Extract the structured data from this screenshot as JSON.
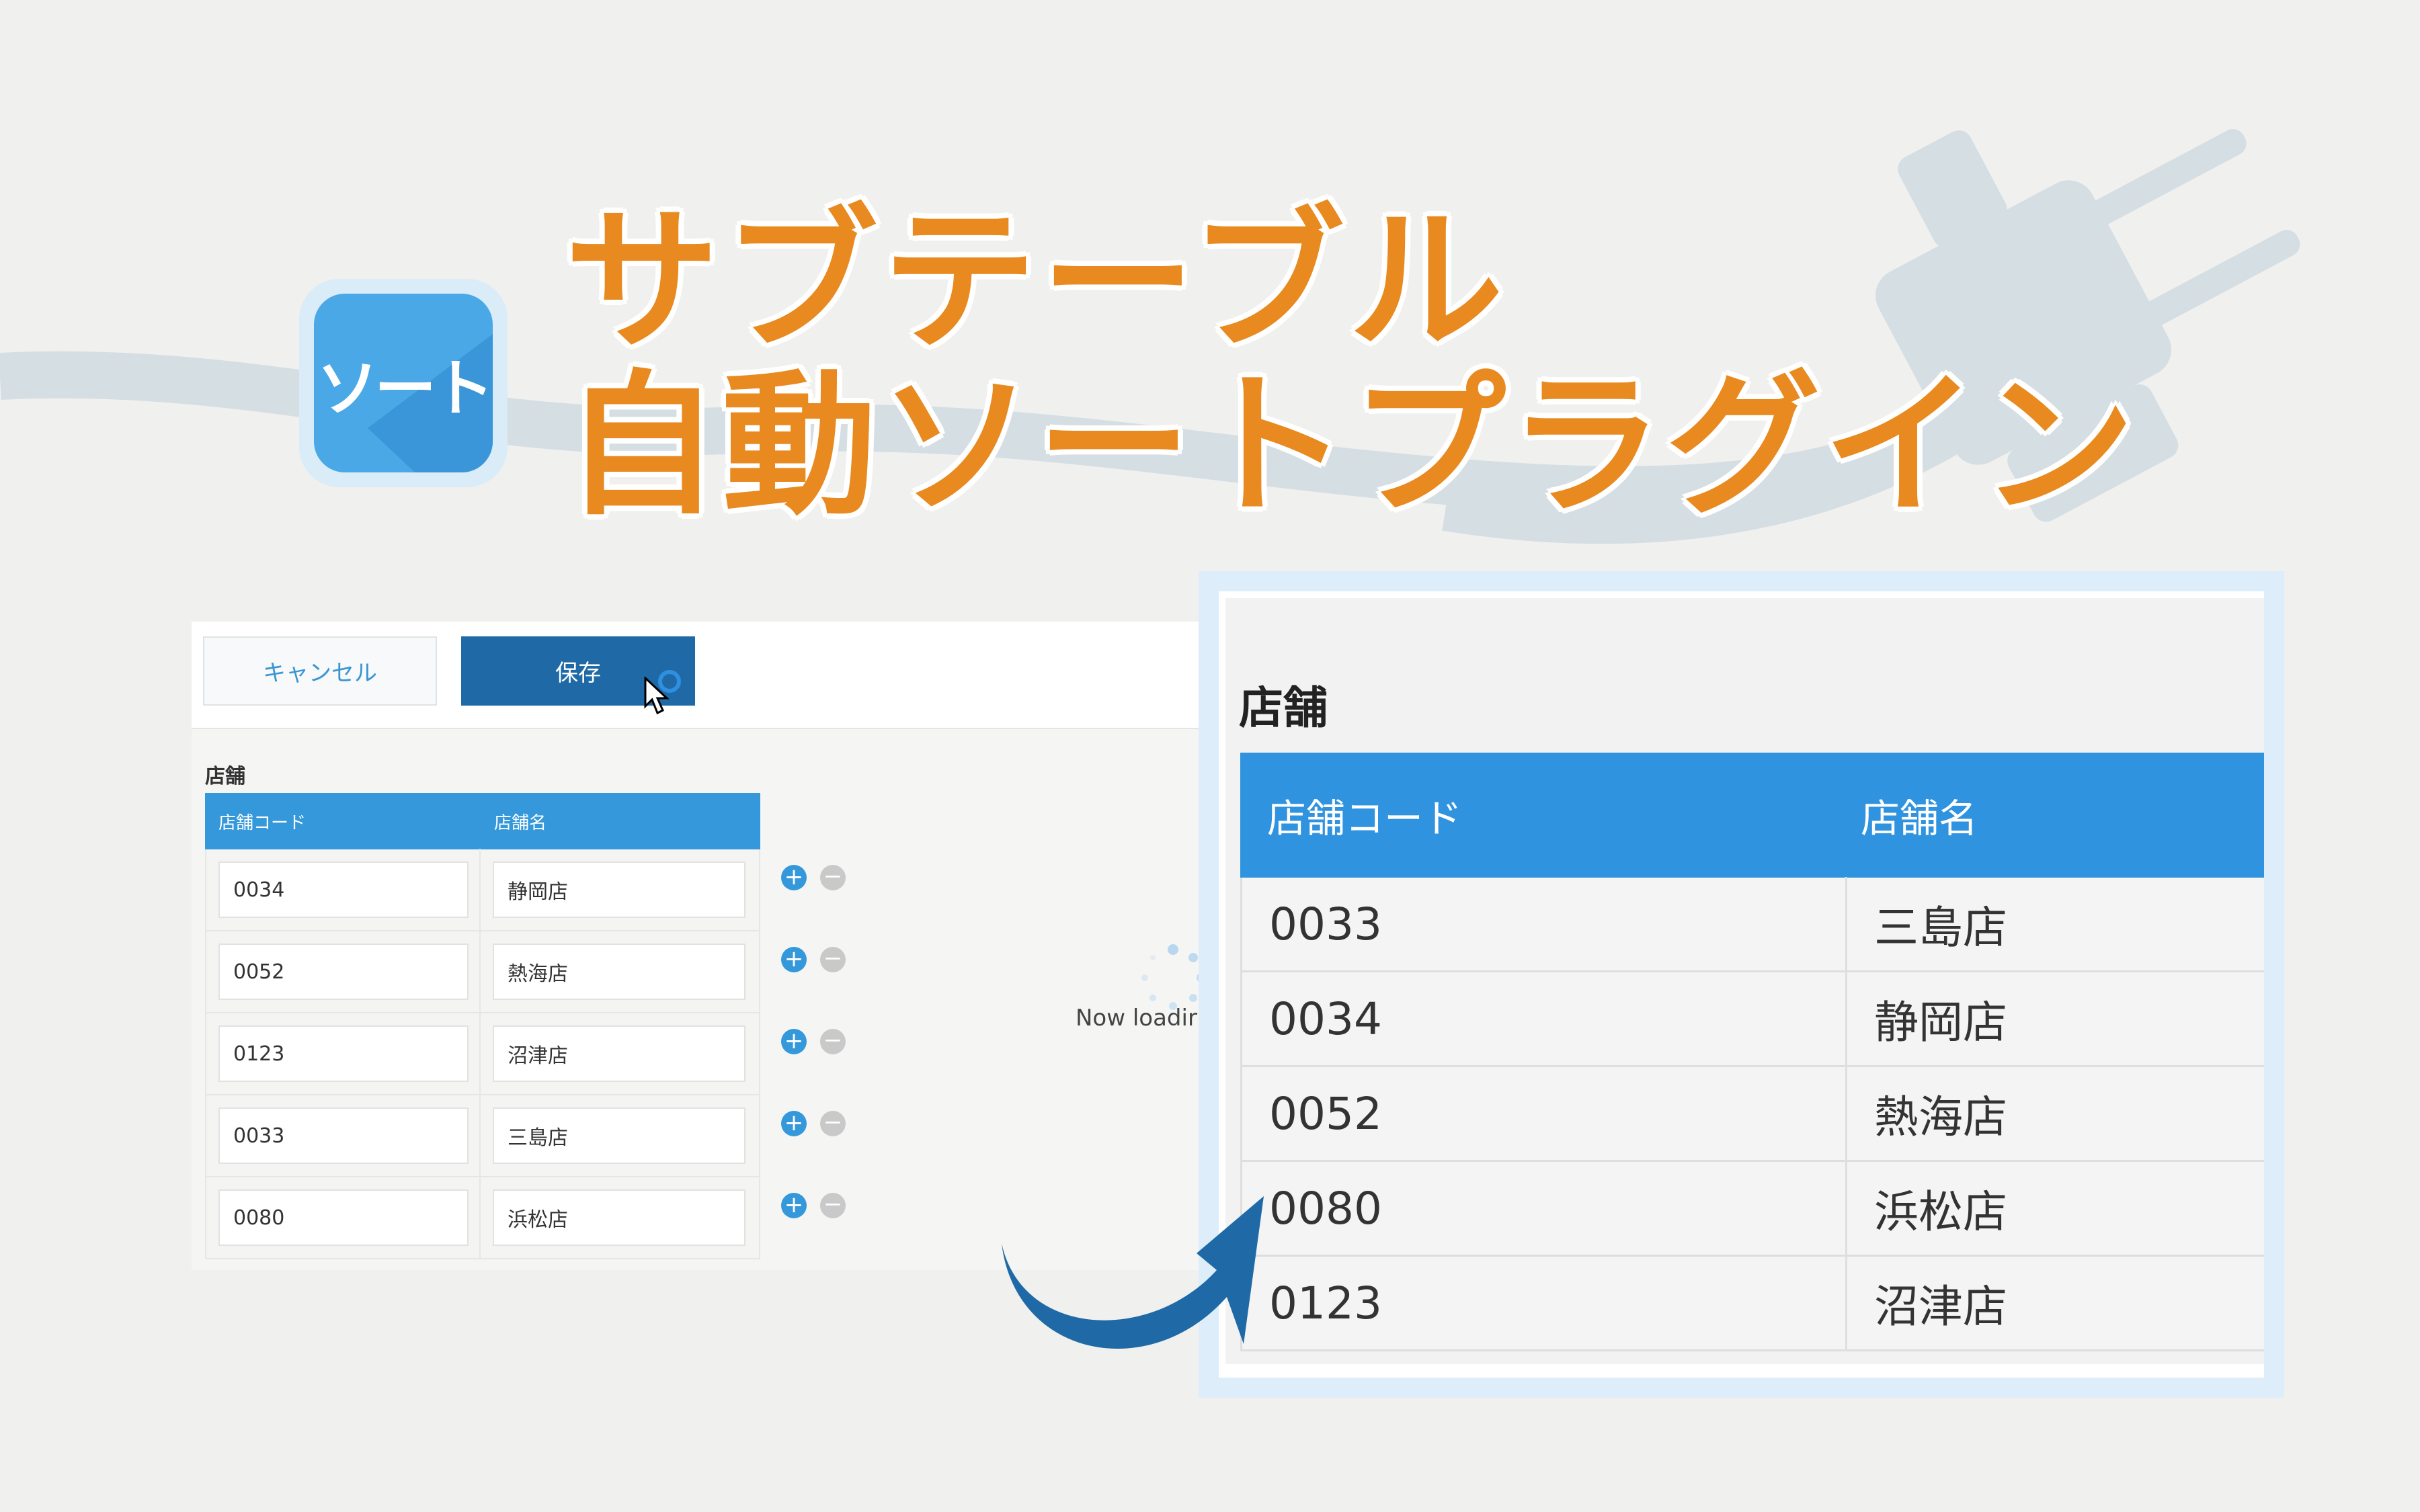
{
  "app": {
    "icon_label": "ソート",
    "title_line1": "サブテーブル",
    "title_line2": "自動ソートプラグイン"
  },
  "colors": {
    "accent_orange": "#e88a1f",
    "header_blue": "#3498db",
    "save_blue": "#1f6aa6",
    "arrow_blue": "#1f6aa6"
  },
  "toolbar": {
    "cancel_label": "キャンセル",
    "save_label": "保存"
  },
  "form": {
    "section_label": "店舗",
    "columns": [
      "店舗コード",
      "店舗名"
    ],
    "rows": [
      {
        "code": "0034",
        "name": "静岡店"
      },
      {
        "code": "0052",
        "name": "熱海店"
      },
      {
        "code": "0123",
        "name": "沼津店"
      },
      {
        "code": "0033",
        "name": "三島店"
      },
      {
        "code": "0080",
        "name": "浜松店"
      }
    ],
    "add_symbol": "+",
    "remove_symbol": "−",
    "loading_text": "Now loadir"
  },
  "sorted": {
    "section_label": "店舗",
    "columns": [
      "店舗コード",
      "店舗名"
    ],
    "rows": [
      {
        "code": "0033",
        "name": "三島店"
      },
      {
        "code": "0034",
        "name": "静岡店"
      },
      {
        "code": "0052",
        "name": "熱海店"
      },
      {
        "code": "0080",
        "name": "浜松店"
      },
      {
        "code": "0123",
        "name": "沼津店"
      }
    ]
  },
  "icons": {
    "plug": "plug-icon",
    "cursor": "mouse-cursor-icon",
    "spinner": "spinner-icon",
    "arrow": "curved-arrow-icon"
  }
}
